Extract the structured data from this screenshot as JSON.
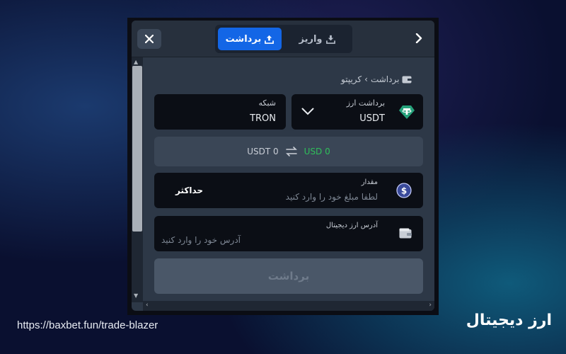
{
  "header": {
    "tabs": [
      {
        "label": "برداشت",
        "icon": "upload-icon",
        "active": true
      },
      {
        "label": "واریز",
        "icon": "download-icon",
        "active": false
      }
    ]
  },
  "breadcrumb": {
    "root": "برداشت",
    "separator": "›",
    "current": "کریپتو"
  },
  "currency": {
    "label": "برداشت ارز",
    "value": "USDT"
  },
  "network": {
    "label": "شبکه",
    "value": "TRON"
  },
  "balance": {
    "usd": "USD 0",
    "crypto": "USDT 0",
    "usd_color": "#2fbf5a"
  },
  "amount": {
    "label": "مقدار",
    "placeholder": "لطفا مبلغ خود را وارد کنید",
    "max_label": "حداکثر"
  },
  "address": {
    "label": "آدرس ارز دیجیتال",
    "placeholder": "آدرس خود را وارد کنید"
  },
  "submit": {
    "label": "برداشت"
  },
  "caption": {
    "url": "https://baxbet.fun/trade-blazer",
    "title": "ارز دیجیتال"
  },
  "colors": {
    "accent": "#1366e6",
    "tether": "#26a17b",
    "dollar_coin": "#3a4a9a"
  }
}
